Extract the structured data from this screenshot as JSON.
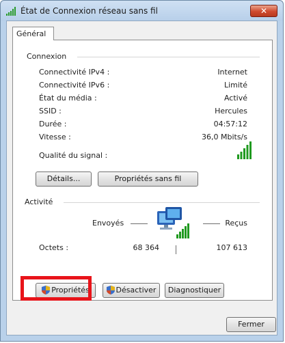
{
  "window": {
    "title": "État de Connexion réseau sans fil",
    "close_label": "✕"
  },
  "tabs": [
    {
      "label": "Général"
    }
  ],
  "connection": {
    "group_title": "Connexion",
    "rows": [
      {
        "label": "Connectivité IPv4 :",
        "value": "Internet"
      },
      {
        "label": "Connectivité IPv6 :",
        "value": "Limité"
      },
      {
        "label": "État du média :",
        "value": "Activé"
      },
      {
        "label": "SSID :",
        "value": "Hercules"
      },
      {
        "label": "Durée :",
        "value": "04:57:12"
      },
      {
        "label": "Vitesse :",
        "value": "36,0 Mbits/s"
      }
    ],
    "signal_label": "Qualité du signal :",
    "signal_bars": 5,
    "signal_color": "#1f9a1f",
    "details_button": "Détails...",
    "wireless_props_button": "Propriétés sans fil"
  },
  "activity": {
    "group_title": "Activité",
    "sent_label": "Envoyés",
    "received_label": "Reçus",
    "bytes_label": "Octets :",
    "bytes_sent": "68 364",
    "bytes_received": "107 613"
  },
  "actions": {
    "properties_button": "Propriétés",
    "disable_button": "Désactiver",
    "diagnose_button": "Diagnostiquer",
    "highlight_color": "#e8141a"
  },
  "footer": {
    "close_button": "Fermer"
  }
}
